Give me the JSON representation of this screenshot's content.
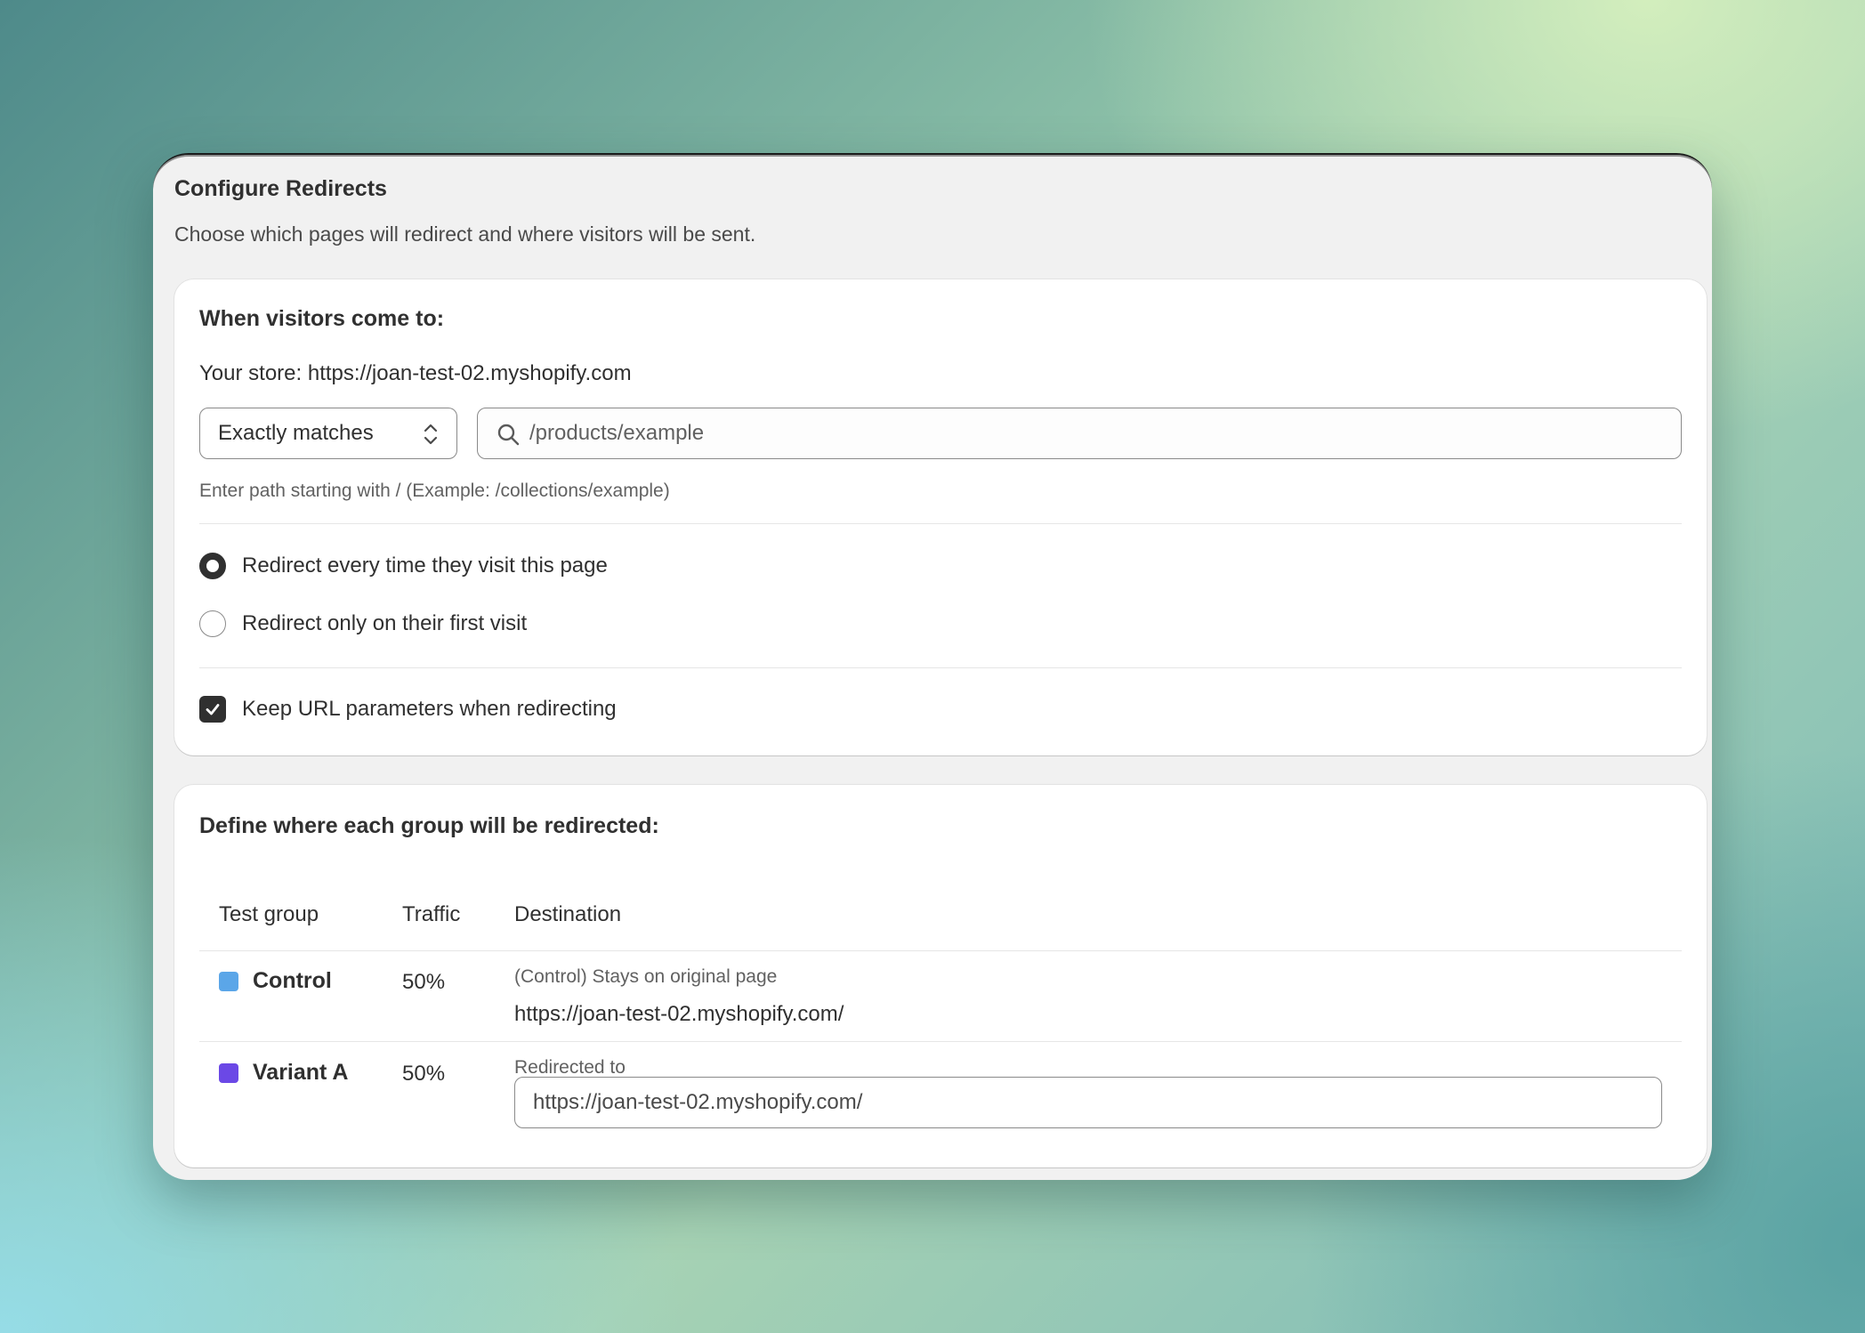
{
  "window": {
    "title": "Configure Redirects",
    "subtitle": "Choose which pages will redirect and where visitors will be sent."
  },
  "source": {
    "heading": "When visitors come to:",
    "store_line": "Your store: https://joan-test-02.myshopify.com",
    "match_select": {
      "value": "Exactly matches"
    },
    "path_input": {
      "placeholder": "/products/example",
      "icon": "search-icon"
    },
    "hint": "Enter path starting with / (Example: /collections/example)",
    "frequency_options": [
      {
        "label": "Redirect every time they visit this page",
        "selected": true
      },
      {
        "label": "Redirect only on their first visit",
        "selected": false
      }
    ],
    "keep_params": {
      "label": "Keep URL parameters when redirecting",
      "checked": true
    }
  },
  "groups": {
    "heading": "Define where each group will be redirected:",
    "columns": [
      "Test group",
      "Traffic",
      "Destination"
    ],
    "rows": [
      {
        "name": "Control",
        "color": "#5ba6e8",
        "traffic": "50%",
        "dest_label": "(Control) Stays on original page",
        "dest_url": "https://joan-test-02.myshopify.com/"
      },
      {
        "name": "Variant A",
        "color": "#6b48e6",
        "traffic": "50%",
        "dest_label": "Redirected to",
        "dest_input": "https://joan-test-02.myshopify.com/"
      }
    ]
  }
}
